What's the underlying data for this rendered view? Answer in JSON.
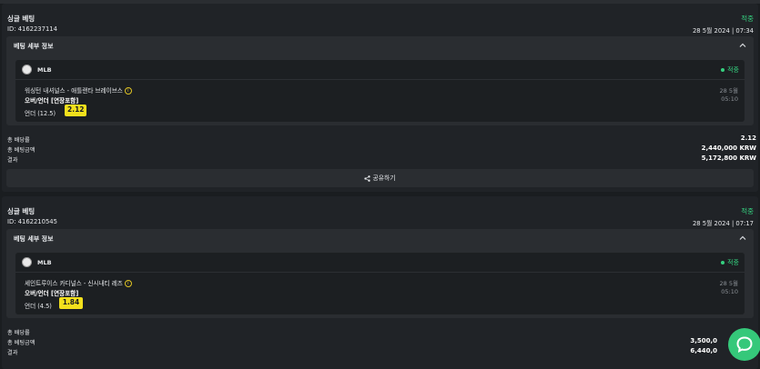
{
  "bets": [
    {
      "type_label": "싱글 베팅",
      "id_label": "ID: 4162237114",
      "status": "적중",
      "datetime": "28 5월 2024 | 07:34",
      "details_title": "베팅 세부 정보",
      "league": "MLB",
      "event_status": "적중",
      "match": "워싱턴 내셔널스 - 애틀랜타 브레이브스",
      "market": "오버/언더 [연장포함]",
      "pick": "언더 (12.5)",
      "odds": "2.12",
      "event_date": "28 5월",
      "event_time": "05:10",
      "totals": [
        {
          "label": "총 배당률",
          "value": "2.12"
        },
        {
          "label": "총 베팅금액",
          "value": "2,440,000 KRW"
        },
        {
          "label": "결과",
          "value": "5,172,800 KRW"
        }
      ],
      "share_label": "공유하기"
    },
    {
      "type_label": "싱글 베팅",
      "id_label": "ID: 4162210545",
      "status": "적중",
      "datetime": "28 5월 2024 | 07:17",
      "details_title": "베팅 세부 정보",
      "league": "MLB",
      "event_status": "적중",
      "match": "세인트루이스 카디널스 - 신시내티 레즈",
      "market": "오버/언더 [연장포함]",
      "pick": "언더 (4.5)",
      "odds": "1.84",
      "event_date": "28 5월",
      "event_time": "05:10",
      "totals": [
        {
          "label": "총 배당률",
          "value": ""
        },
        {
          "label": "총 베팅금액",
          "value": "3,500,0"
        },
        {
          "label": "결과",
          "value": "6,440,0"
        }
      ]
    }
  ],
  "colors": {
    "win_green": "#35d07f",
    "odds_yellow": "#f2e01c",
    "chat_green": "#35c87a"
  },
  "icons": {
    "info": "info-icon",
    "collapse": "chevron-up-icon",
    "share": "share-icon",
    "chat": "chat-icon",
    "league": "baseball-icon"
  }
}
